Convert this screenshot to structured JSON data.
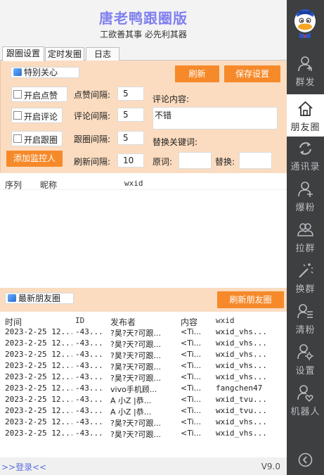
{
  "header": {
    "title": "唐老鸭跟圈版",
    "subtitle": "工欲善其事 必先利其器"
  },
  "tabs": [
    {
      "label": "跟圈设置",
      "active": true
    },
    {
      "label": "定时发圈",
      "active": false
    },
    {
      "label": "日志",
      "active": false
    }
  ],
  "settings": {
    "special_group_label": "特别关心",
    "refresh_button": "刷新",
    "save_button": "保存设置",
    "checkboxes": [
      {
        "label": "开启点赞",
        "checked": false
      },
      {
        "label": "开启评论",
        "checked": false
      },
      {
        "label": "开启跟圈",
        "checked": false
      }
    ],
    "add_monitor_button": "添加监控人",
    "like_interval_label": "点赞间隔:",
    "like_interval_value": "5",
    "comment_interval_label": "评论间隔:",
    "comment_interval_value": "5",
    "follow_interval_label": "跟圈间隔:",
    "follow_interval_value": "5",
    "refresh_interval_label": "刷新间隔:",
    "refresh_interval_value": "10",
    "comment_content_label": "评论内容:",
    "comment_content_value": "不错",
    "replace_keyword_label": "替换关键词:",
    "original_word_label": "原词:",
    "original_word_value": "",
    "replace_with_label": "替换:",
    "replace_with_value": ""
  },
  "monitor_list": {
    "columns": [
      "序列",
      "昵称",
      "wxid"
    ]
  },
  "friends": {
    "group_label": "最新朋友圈",
    "refresh_button": "刷新朋友圈",
    "columns": [
      "时间",
      "ID",
      "发布者",
      "内容",
      "wxid"
    ],
    "rows": [
      [
        "2023-2-25 12...",
        "-43...",
        "?昊?天?可跟...",
        "<Ti...",
        "wxid_vhs..."
      ],
      [
        "2023-2-25 12...",
        "-43...",
        "?昊?天?可跟...",
        "<Ti...",
        "wxid_vhs..."
      ],
      [
        "2023-2-25 12...",
        "-43...",
        "?昊?天?可跟...",
        "<Ti...",
        "wxid_vhs..."
      ],
      [
        "2023-2-25 12...",
        "-43...",
        "?昊?天?可跟...",
        "<Ti...",
        "wxid_vhs..."
      ],
      [
        "2023-2-25 12...",
        "-43...",
        "?昊?天?可跟...",
        "<Ti...",
        "wxid_vhs..."
      ],
      [
        "2023-2-25 12...",
        "-43...",
        "vivo手机顾...",
        "<Ti...",
        "fangchen47"
      ],
      [
        "2023-2-25 12...",
        "-43...",
        "A 小Z  |恭...",
        "<Ti...",
        "wxid_tvu..."
      ],
      [
        "2023-2-25 12...",
        "-43...",
        "A 小Z  |恭...",
        "<Ti...",
        "wxid_tvu..."
      ],
      [
        "2023-2-25 12...",
        "-43...",
        "?昊?天?可跟...",
        "<Ti...",
        "wxid_vhs..."
      ],
      [
        "2023-2-25 12...",
        "-43...",
        "?昊?天?可跟...",
        "<Ti...",
        "wxid_vhs..."
      ]
    ]
  },
  "footer": {
    "login_link": ">>登录<<",
    "version": "V9.0"
  },
  "sidebar": {
    "avatar_icon": "donald-duck-avatar-icon",
    "items": [
      {
        "label": "群发",
        "icon": "user-broadcast-icon",
        "active": false
      },
      {
        "label": "朋友圈",
        "icon": "home-icon",
        "active": true
      },
      {
        "label": "通讯录",
        "icon": "sync-icon",
        "active": false
      },
      {
        "label": "爆粉",
        "icon": "user-add-icon",
        "active": false
      },
      {
        "label": "拉群",
        "icon": "group-icon",
        "active": false
      },
      {
        "label": "换群",
        "icon": "magic-wand-icon",
        "active": false
      },
      {
        "label": "清粉",
        "icon": "user-list-icon",
        "active": false
      },
      {
        "label": "设置",
        "icon": "user-gear-icon",
        "active": false
      },
      {
        "label": "机器人",
        "icon": "user-heart-icon",
        "active": false
      }
    ],
    "collapse_icon": "chevron-left-circle-icon"
  },
  "colors": {
    "accent": "#f68a2b",
    "panel": "#fbdcc0",
    "title": "#7f7ff0",
    "sidebar": "#3d3f41"
  }
}
